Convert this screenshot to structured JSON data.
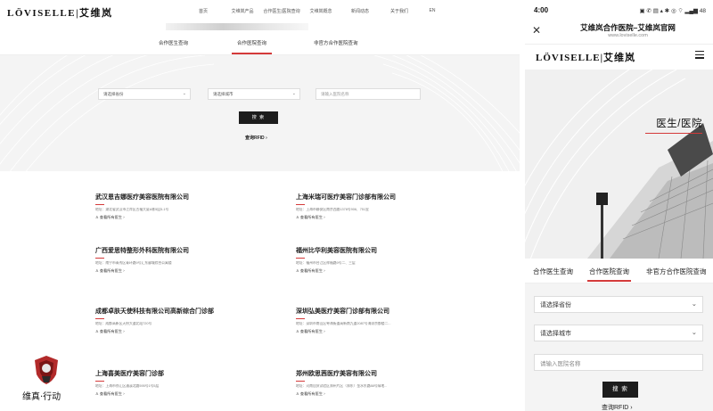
{
  "desktop": {
    "logo": "LÖVISELLE|艾维岚",
    "nav": [
      "首页",
      "艾维岚产品",
      "合作医生|医院查询",
      "艾维岚概念",
      "新闻动态",
      "关于我们",
      "EN"
    ],
    "tabs": [
      "合作医生查询",
      "合作医院查询",
      "非官方合作医院查询"
    ],
    "active_tab": 1,
    "search": {
      "province_placeholder": "请选择省份",
      "city_placeholder": "请选择城市",
      "name_placeholder": "请输入医院名称",
      "button": "搜 索",
      "rfid_link": "查询RFID"
    },
    "hospitals": [
      {
        "name": "武汉恩吉娜医疗美容医院有限公司",
        "address": "地址：湖北省武汉市江岸区五福大厦A栋5层5-1号",
        "doctor_link": "查看所有医生"
      },
      {
        "name": "上海米瑞可医疗美容门诊部有限公司",
        "address": "地址：上海市静安区南京西路1376号906、751室",
        "doctor_link": "查看所有医生"
      },
      {
        "name": "广西爱思特整形外科医院有限公司",
        "address": "地址：南宁市青秀区青环路9号汇东郦城综合公寓楼",
        "doctor_link": "查看所有医生"
      },
      {
        "name": "福州比华利美容医院有限公司",
        "address": "地址：福州市台江区祥福路9号二、三层",
        "doctor_link": "查看所有医生"
      },
      {
        "name": "成都卓肤天使科技有限公司高新综合门诊部",
        "address": "地址：成都高新区天府大道北段720号",
        "doctor_link": "查看所有医生"
      },
      {
        "name": "深圳弘美医疗美容门诊部有限公司",
        "address": "地址：深圳市南山区粤海街道高新南九道2087号海派京都楼二...",
        "doctor_link": "查看所有医生"
      },
      {
        "name": "上海喜美医疗美容门诊部",
        "address": "地址：上海市徐汇区漕溪北路595号1号5层",
        "doctor_link": "查看所有医生"
      },
      {
        "name": "郑州欧思茜医疗美容有限公司",
        "address": "地址：河南自贸试验区郑州片区（郑东）金水东路88号绿地...",
        "doctor_link": "查看所有医生"
      }
    ],
    "badge_label": "维真·行动"
  },
  "mobile": {
    "status_time": "4:00",
    "status_icons": "▣ ✆ ▤ ▴ ✱ ◎ ⌔ ▂▄▆ 48",
    "page_title": "艾维岚合作医院–艾维岚官网",
    "url": "www.loviselle.com",
    "logo": "LÖVISELLE|艾维岚",
    "hero_title": "医生/医院",
    "tabs": [
      "合作医生查询",
      "合作医院查询",
      "非官方合作医院查询"
    ],
    "active_tab": 1,
    "province_placeholder": "请选择省份",
    "city_placeholder": "请选择城市",
    "name_placeholder": "请输入医院名称",
    "button": "搜 索",
    "rfid_link": "查询RFID"
  },
  "colors": {
    "accent": "#d43a3a",
    "button": "#1d1d1d",
    "panel_bg": "#f4f4f4"
  }
}
